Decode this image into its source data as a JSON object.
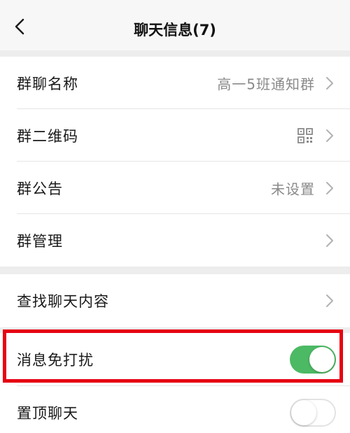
{
  "header": {
    "title": "聊天信息(7)",
    "back_icon": "chevron-left-icon"
  },
  "group_info": {
    "name_label": "群聊名称",
    "name_value": "高一5班通知群",
    "qrcode_label": "群二维码",
    "qrcode_icon": "qr-code-icon",
    "announcement_label": "群公告",
    "announcement_value": "未设置",
    "manage_label": "群管理"
  },
  "settings": {
    "search_label": "查找聊天内容",
    "mute_label": "消息免打扰",
    "mute_enabled": true,
    "pin_label": "置顶聊天",
    "pin_enabled": false
  },
  "colors": {
    "toggle_on": "#4cb964",
    "highlight_border": "#e60012",
    "background": "#ededed"
  }
}
